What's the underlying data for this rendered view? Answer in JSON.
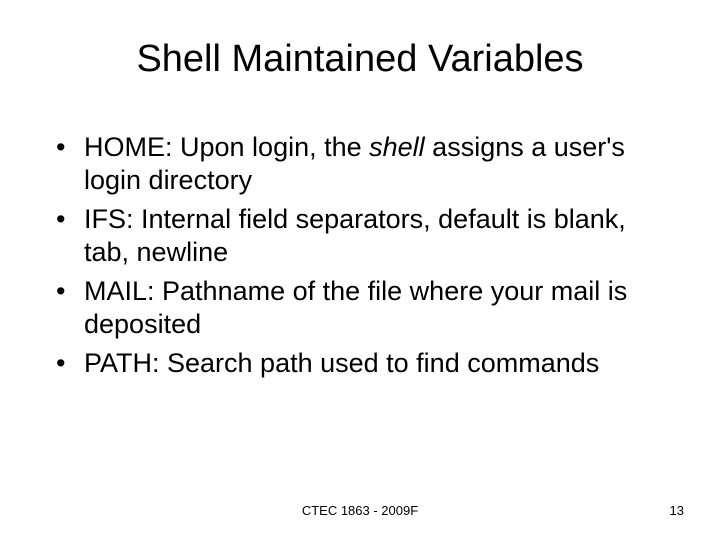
{
  "title": "Shell Maintained Variables",
  "bullets": [
    {
      "pre": "HOME: Upon login, the ",
      "em": "shell",
      "post": " assigns a user's login directory"
    },
    {
      "pre": "IFS: Internal field separators, default is blank, tab, newline",
      "em": "",
      "post": ""
    },
    {
      "pre": "MAIL: Pathname of the file where your mail is deposited",
      "em": "",
      "post": ""
    },
    {
      "pre": "PATH: Search path used to find commands",
      "em": "",
      "post": ""
    }
  ],
  "footer": "CTEC 1863 - 2009F",
  "page": "13"
}
